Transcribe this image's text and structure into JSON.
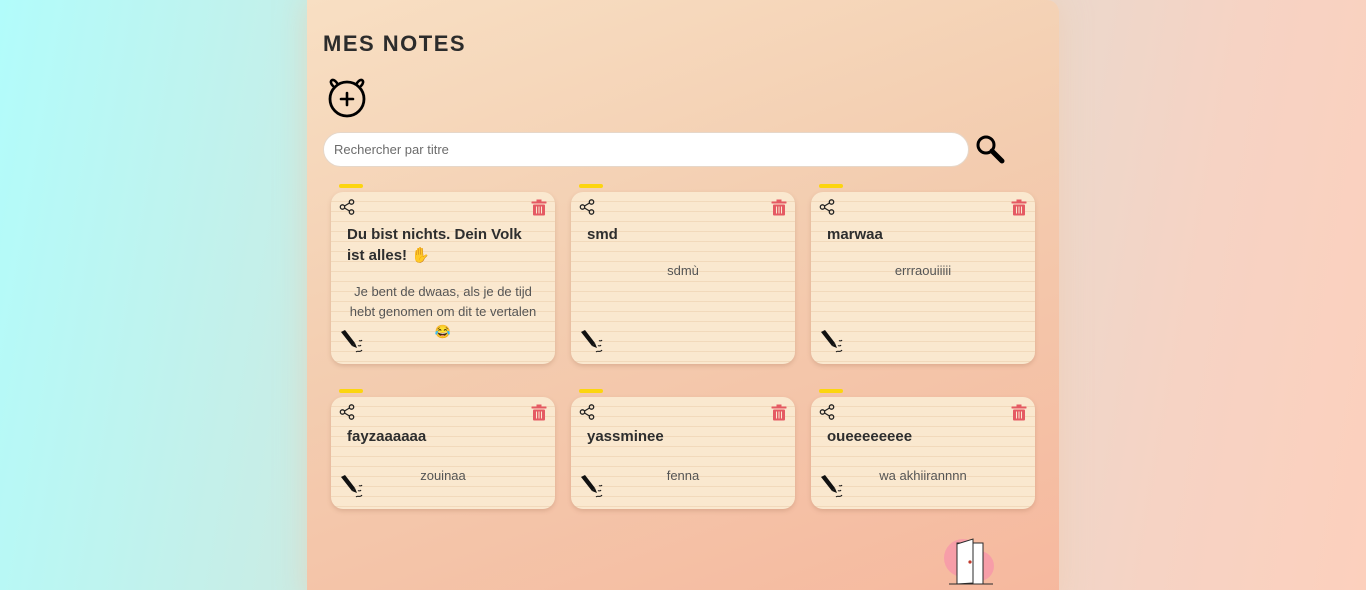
{
  "header": {
    "title": "MES NOTES"
  },
  "search": {
    "placeholder": "Rechercher par titre",
    "value": ""
  },
  "icons": {
    "add": "add-note-icon",
    "search": "magnifier-icon",
    "share": "share-icon",
    "delete": "trash-icon",
    "edit": "pen-icon",
    "logout": "door-icon"
  },
  "colors": {
    "accent_tab": "#fcd50f",
    "delete": "#e55a63",
    "card_bg": "#fae8cf"
  },
  "notes": [
    {
      "title": "Du bist nichts. Dein Volk ist alles! ✋",
      "content": "Je bent de dwaas, als je de tijd hebt genomen om dit te vertalen 😂"
    },
    {
      "title": "smd",
      "content": "sdmù"
    },
    {
      "title": "marwaa",
      "content": "errraouiiiii"
    },
    {
      "title": "fayzaaaaaa",
      "content": "zouinaa"
    },
    {
      "title": "yassminee",
      "content": "fenna"
    },
    {
      "title": "oueeeeeeee",
      "content": "wa akhiirannnn"
    }
  ]
}
